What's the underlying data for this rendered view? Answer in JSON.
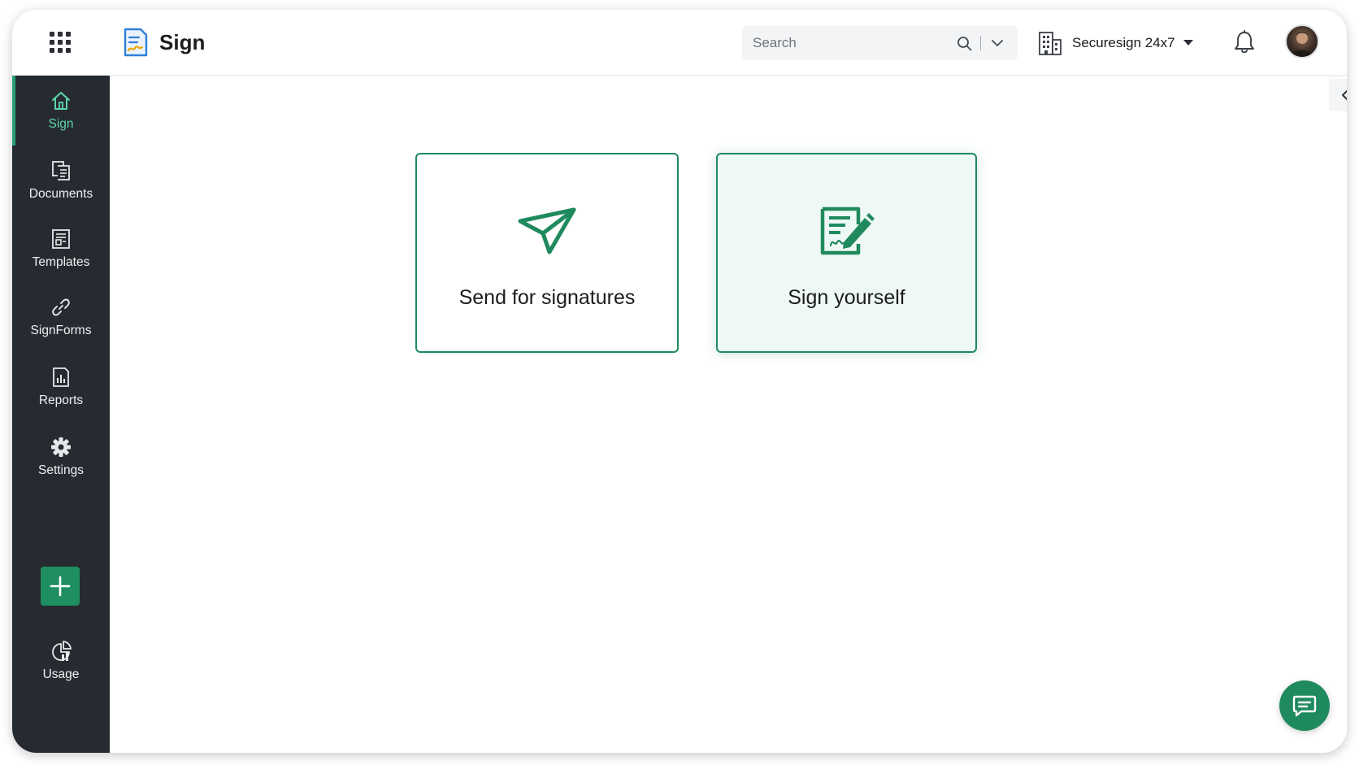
{
  "header": {
    "app_name": "Sign",
    "apps_icon": "apps-grid-icon",
    "logo_icon": "sign-document-logo",
    "search": {
      "placeholder": "Search",
      "value": ""
    },
    "org_name": "Securesign 24x7",
    "org_icon": "building-icon",
    "notifications_icon": "bell-icon",
    "avatar_icon": "user-avatar"
  },
  "sidebar": {
    "items": [
      {
        "label": "Sign",
        "icon": "home-icon",
        "active": true
      },
      {
        "label": "Documents",
        "icon": "documents-icon",
        "active": false
      },
      {
        "label": "Templates",
        "icon": "templates-icon",
        "active": false
      },
      {
        "label": "SignForms",
        "icon": "link-icon",
        "active": false
      },
      {
        "label": "Reports",
        "icon": "reports-icon",
        "active": false
      },
      {
        "label": "Settings",
        "icon": "gear-icon",
        "active": false
      }
    ],
    "add_button_icon": "plus-icon",
    "usage": {
      "label": "Usage",
      "icon": "usage-chart-icon"
    }
  },
  "main": {
    "cards": [
      {
        "label": "Send for signatures",
        "icon": "paper-plane-icon",
        "selected": false
      },
      {
        "label": "Sign yourself",
        "icon": "sign-document-icon",
        "selected": true
      }
    ],
    "collapse_icon": "chevron-left-icon",
    "chat_icon": "chat-icon"
  },
  "colors": {
    "accent": "#1f8a5e",
    "sidebar_bg": "#262b31",
    "active_label": "#5fd4ac",
    "card_selected_bg": "#eef8f4"
  }
}
